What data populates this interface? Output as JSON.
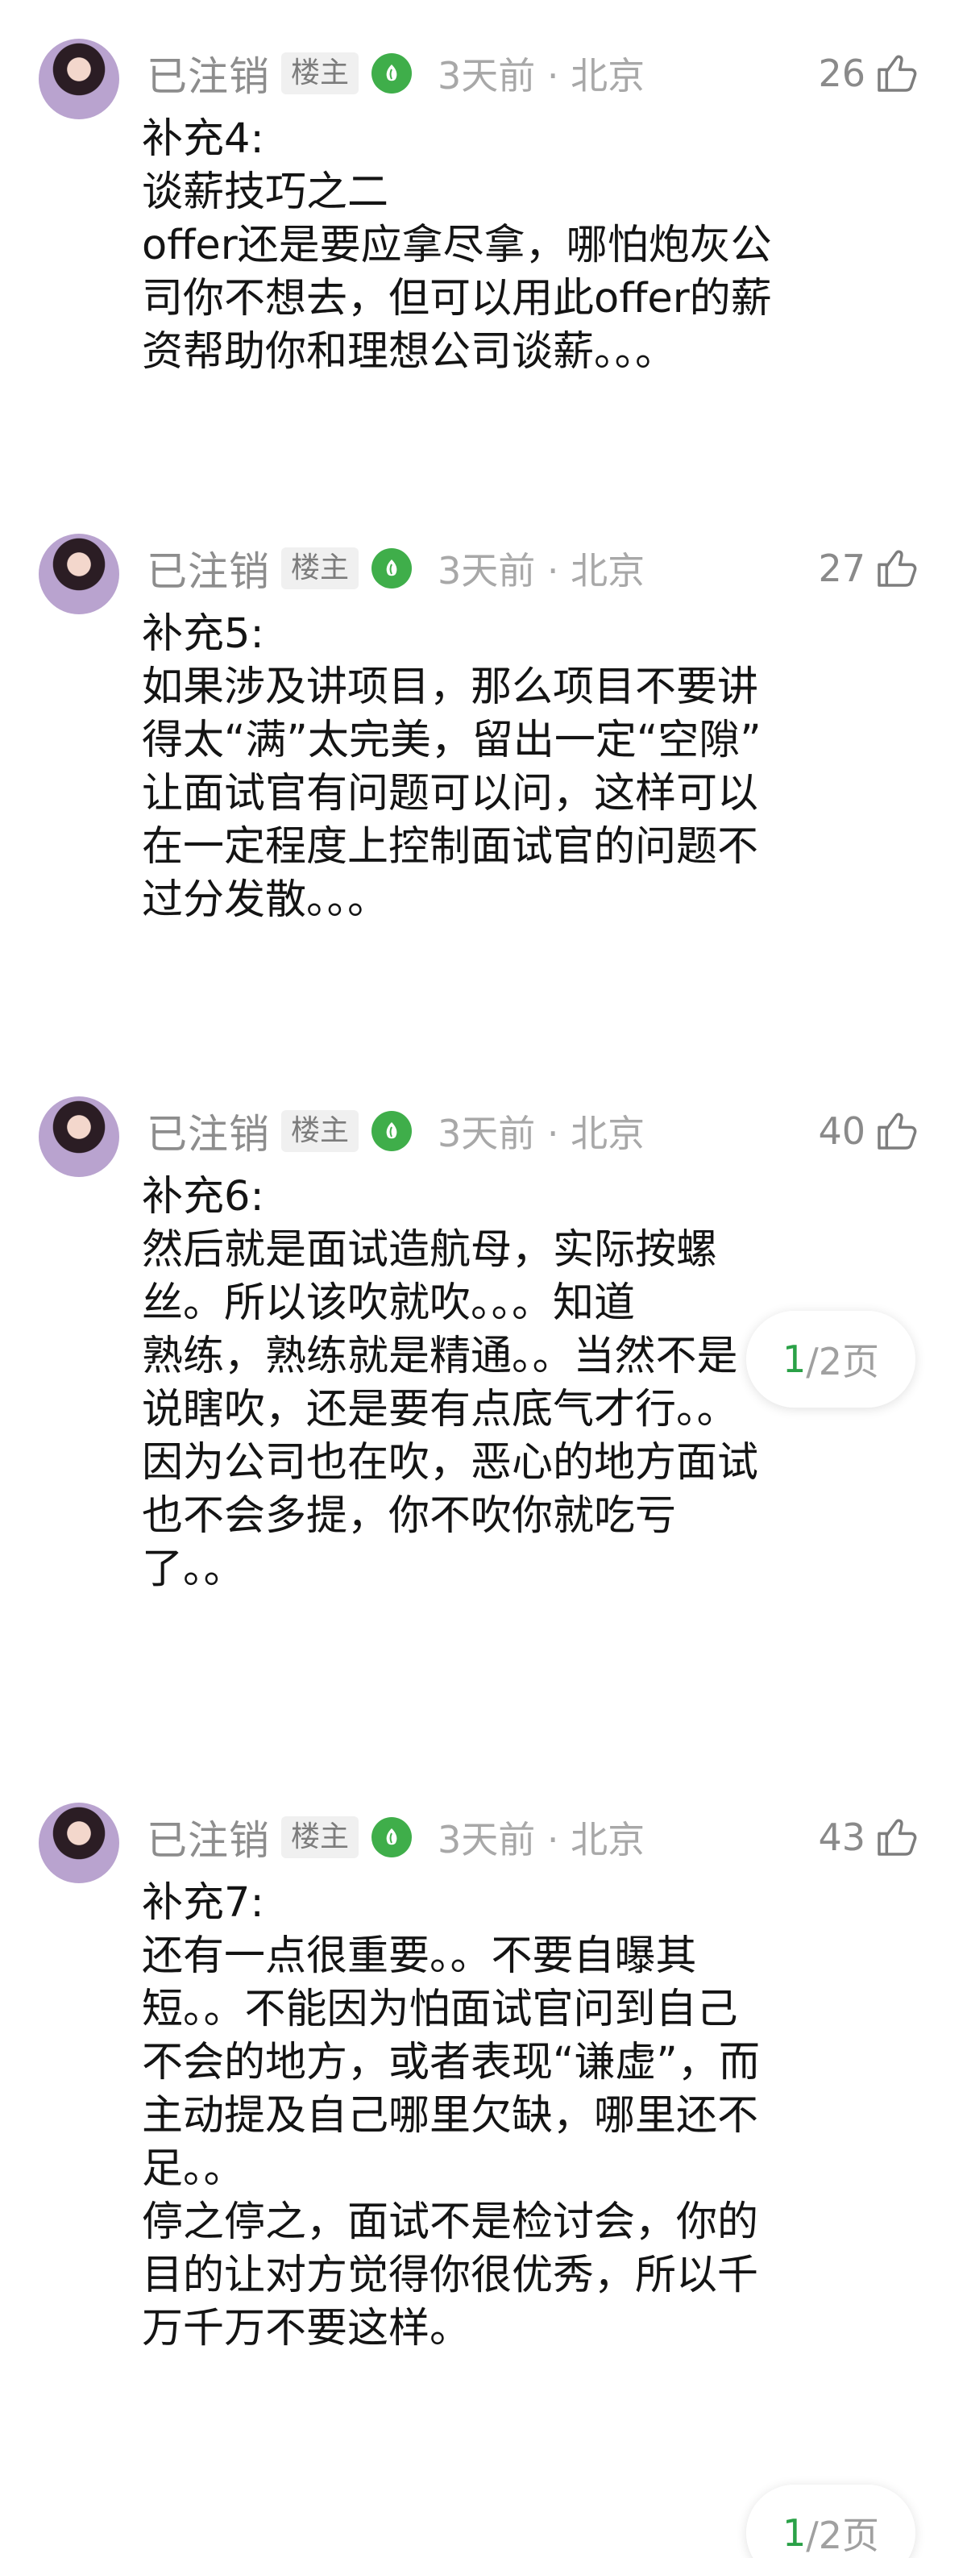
{
  "posts": [
    {
      "username": "已注销",
      "badge": "楼主",
      "meta": "3天前 · 北京",
      "likes": "26",
      "lines": [
        "补充4:",
        "谈薪技巧之二",
        "offer还是要应拿尽拿，哪怕炮灰公",
        "司你不想去，但可以用此offer的薪",
        "资帮助你和理想公司谈薪。。。"
      ]
    },
    {
      "username": "已注销",
      "badge": "楼主",
      "meta": "3天前 · 北京",
      "likes": "27",
      "lines": [
        "补充5:",
        "如果涉及讲项目，那么项目不要讲",
        "得太“满”太完美，留出一定“空隙”",
        "让面试官有问题可以问，这样可以",
        "在一定程度上控制面试官的问题不",
        "过分发散。。。"
      ]
    },
    {
      "username": "已注销",
      "badge": "楼主",
      "meta": "3天前 · 北京",
      "likes": "40",
      "lines": [
        "补充6:",
        "然后就是面试造航母，实际按螺",
        "丝。所以该吹就吹。。。知道",
        "熟练，熟练就是精通。。当然不是",
        "说瞎吹，还是要有点底气才行。。",
        "因为公司也在吹，恶心的地方面试",
        "也不会多提，你不吹你就吃亏",
        "了。。"
      ]
    },
    {
      "username": "已注销",
      "badge": "楼主",
      "meta": "3天前 · 北京",
      "likes": "43",
      "lines": [
        "补充7:",
        "还有一点很重要。。不要自曝其",
        "短。。不能因为怕面试官问到自己",
        "不会的地方，或者表现“谦虚”，而",
        "主动提及自己哪里欠缺，哪里还不",
        "足。。",
        "停之停之，面试不是检讨会，你的",
        "目的让对方觉得你很优秀，所以千",
        "万千万不要这样。"
      ]
    }
  ],
  "pager": {
    "current": "1",
    "total_label": "/2页"
  },
  "colors": {
    "accent_green": "#2aa147",
    "level_icon": "#3fae4a",
    "meta_gray": "#a8a8a8"
  }
}
